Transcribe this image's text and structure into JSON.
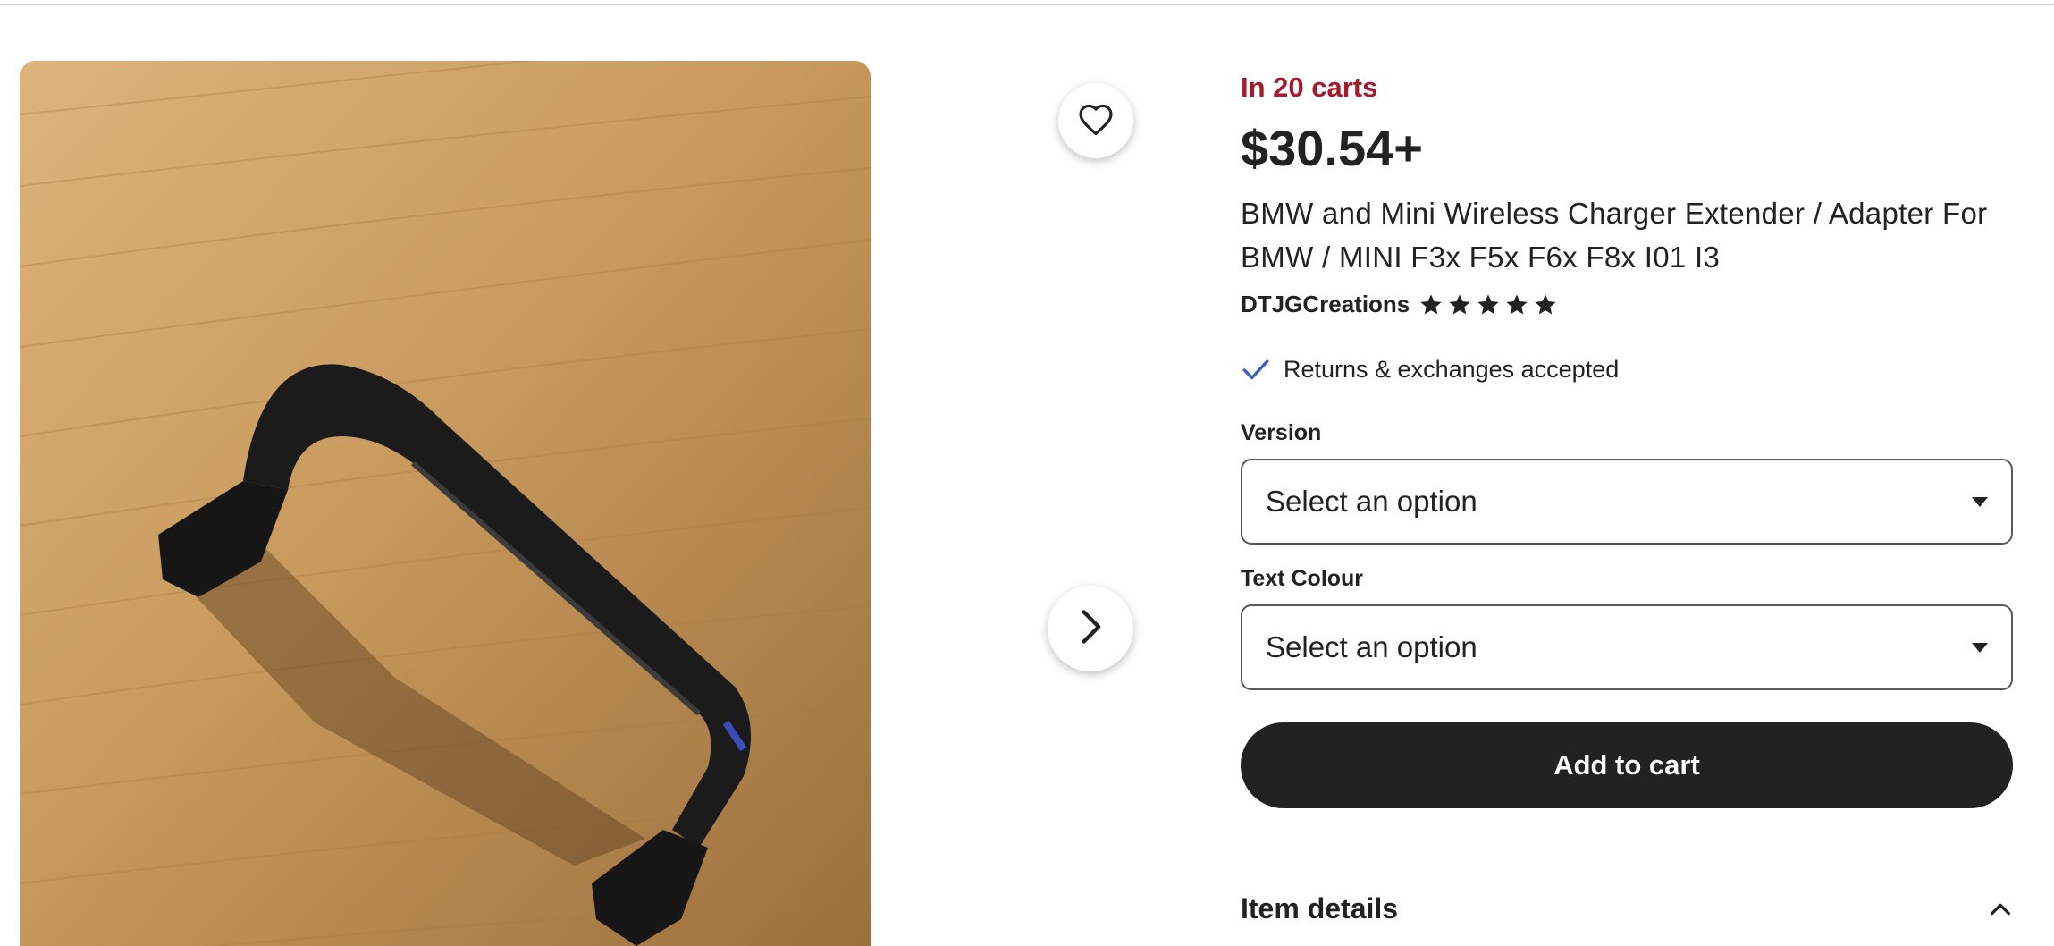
{
  "product": {
    "image_alt": "Black 3D-printed bracket adapter on wooden surface",
    "carts_text": "In 20 carts",
    "price": "$30.54+",
    "title": "BMW and Mini Wireless Charger Extender / Adapter For BMW / MINI F3x F5x F6x F8x I01 I3",
    "shop_name": "DTJGCreations",
    "rating": 5,
    "returns_text": "Returns & exchanges accepted"
  },
  "options": {
    "version_label": "Version",
    "version_value": "Select an option",
    "text_colour_label": "Text Colour",
    "text_colour_value": "Select an option"
  },
  "actions": {
    "add_to_cart": "Add to cart",
    "item_details": "Item details"
  },
  "icons": {
    "favorite": "heart-icon",
    "next": "chevron-right-icon",
    "check": "check-icon",
    "collapse": "chevron-up-icon"
  },
  "colors": {
    "carts_accent": "#a61a2e",
    "check_blue": "#3b5ec9",
    "button_dark": "#222222"
  }
}
